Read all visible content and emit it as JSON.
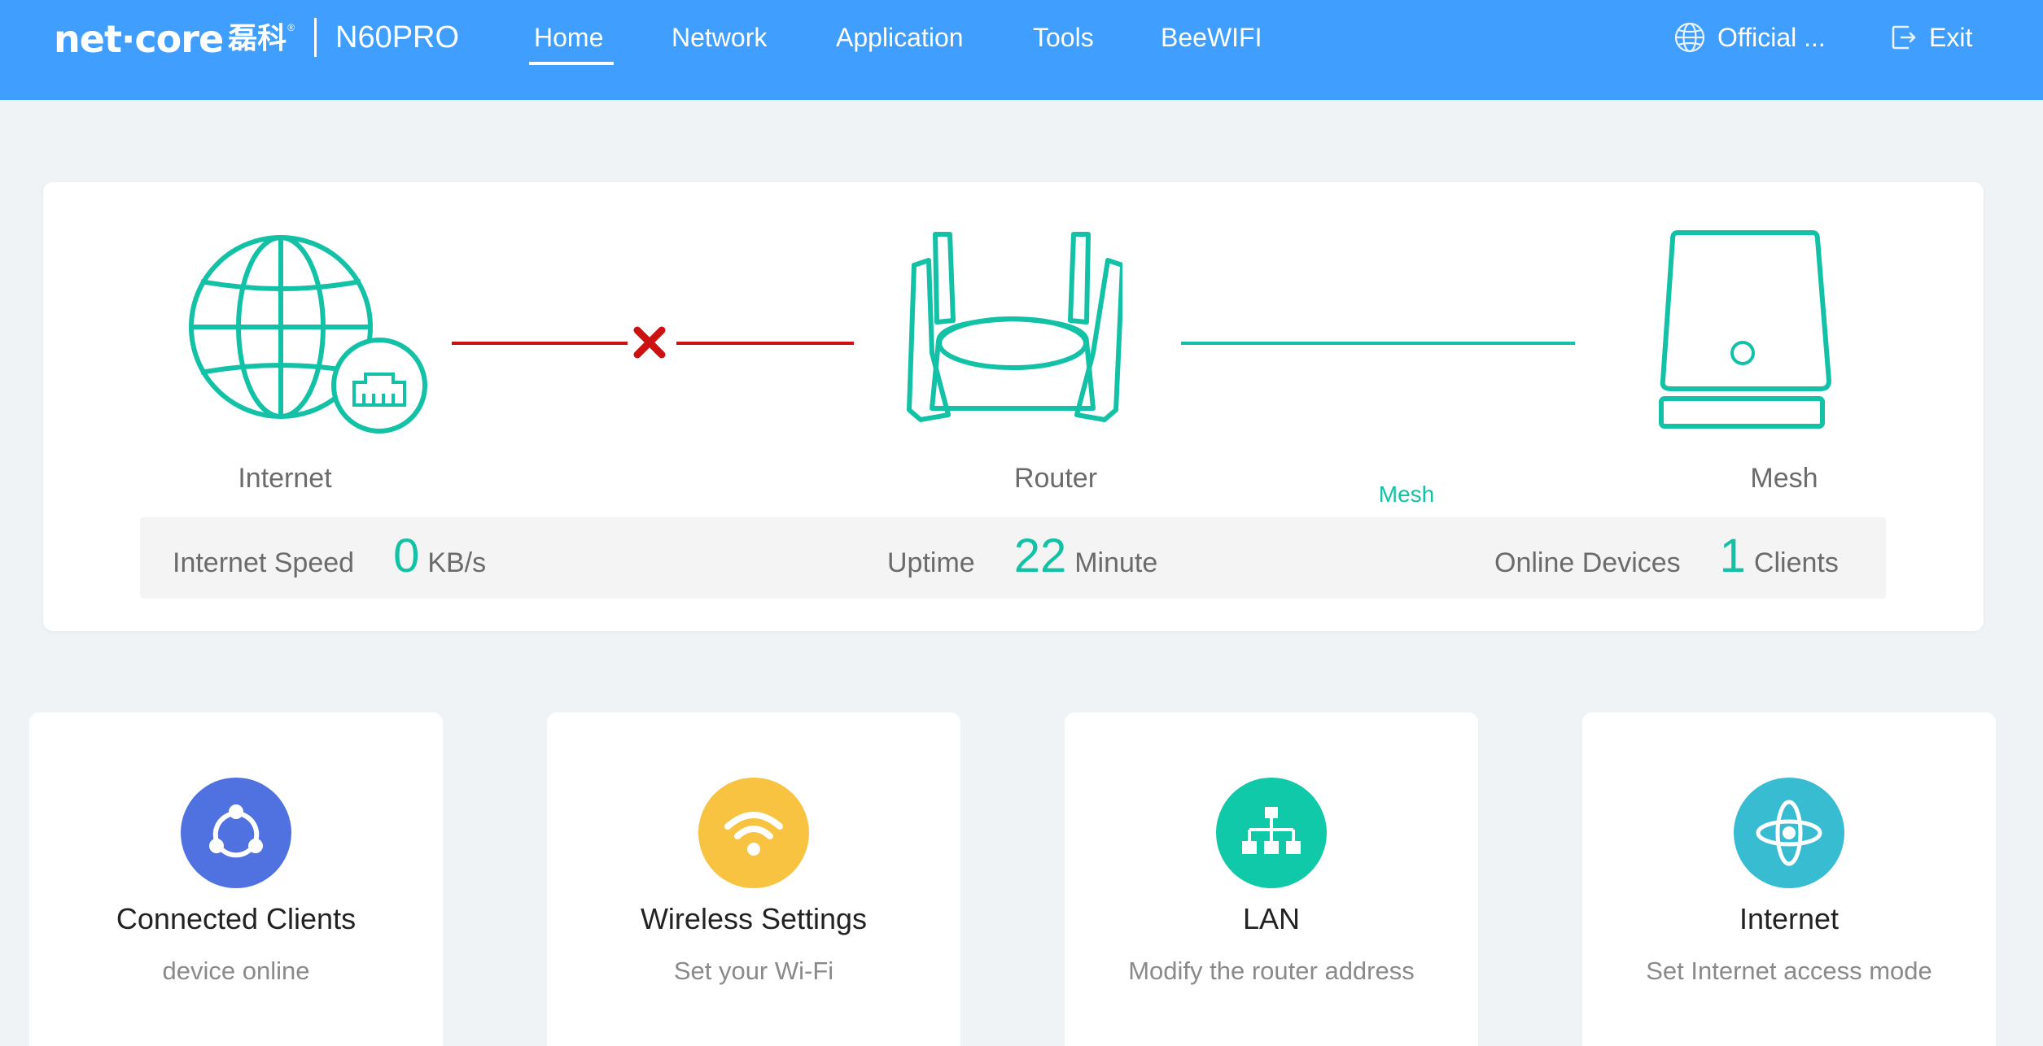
{
  "header": {
    "logo_text": "net·core",
    "logo_cn": "磊科",
    "logo_reg": "®",
    "model": "N60PRO",
    "nav": [
      {
        "label": "Home",
        "active": true
      },
      {
        "label": "Network"
      },
      {
        "label": "Application"
      },
      {
        "label": "Tools"
      },
      {
        "label": "BeeWIFI"
      }
    ],
    "official_label": "Official ...",
    "exit_label": "Exit"
  },
  "topology": {
    "internet_label": "Internet",
    "router_label": "Router",
    "mesh_label": "Mesh",
    "mesh_link_label": "Mesh",
    "internet_link_status": "disconnected",
    "colors": {
      "accent": "#13c2a6",
      "error": "#cc1111",
      "header": "#409eff"
    }
  },
  "stats": {
    "speed_label": "Internet Speed",
    "speed_value": "0",
    "speed_unit": "KB/s",
    "uptime_label": "Uptime",
    "uptime_value": "22",
    "uptime_unit": "Minute",
    "devices_label": "Online Devices",
    "devices_value": "1",
    "devices_unit": "Clients"
  },
  "cards": [
    {
      "title": "Connected Clients",
      "desc": "device online",
      "icon": "share-nodes-icon",
      "color": "#4f72e0"
    },
    {
      "title": "Wireless Settings",
      "desc": "Set your Wi-Fi",
      "icon": "wifi-icon",
      "color": "#f7c340"
    },
    {
      "title": "LAN",
      "desc": "Modify the router address",
      "icon": "network-tree-icon",
      "color": "#10c9a8"
    },
    {
      "title": "Internet",
      "desc": "Set Internet access mode",
      "icon": "satellite-orbit-icon",
      "color": "#37bcd2"
    }
  ]
}
